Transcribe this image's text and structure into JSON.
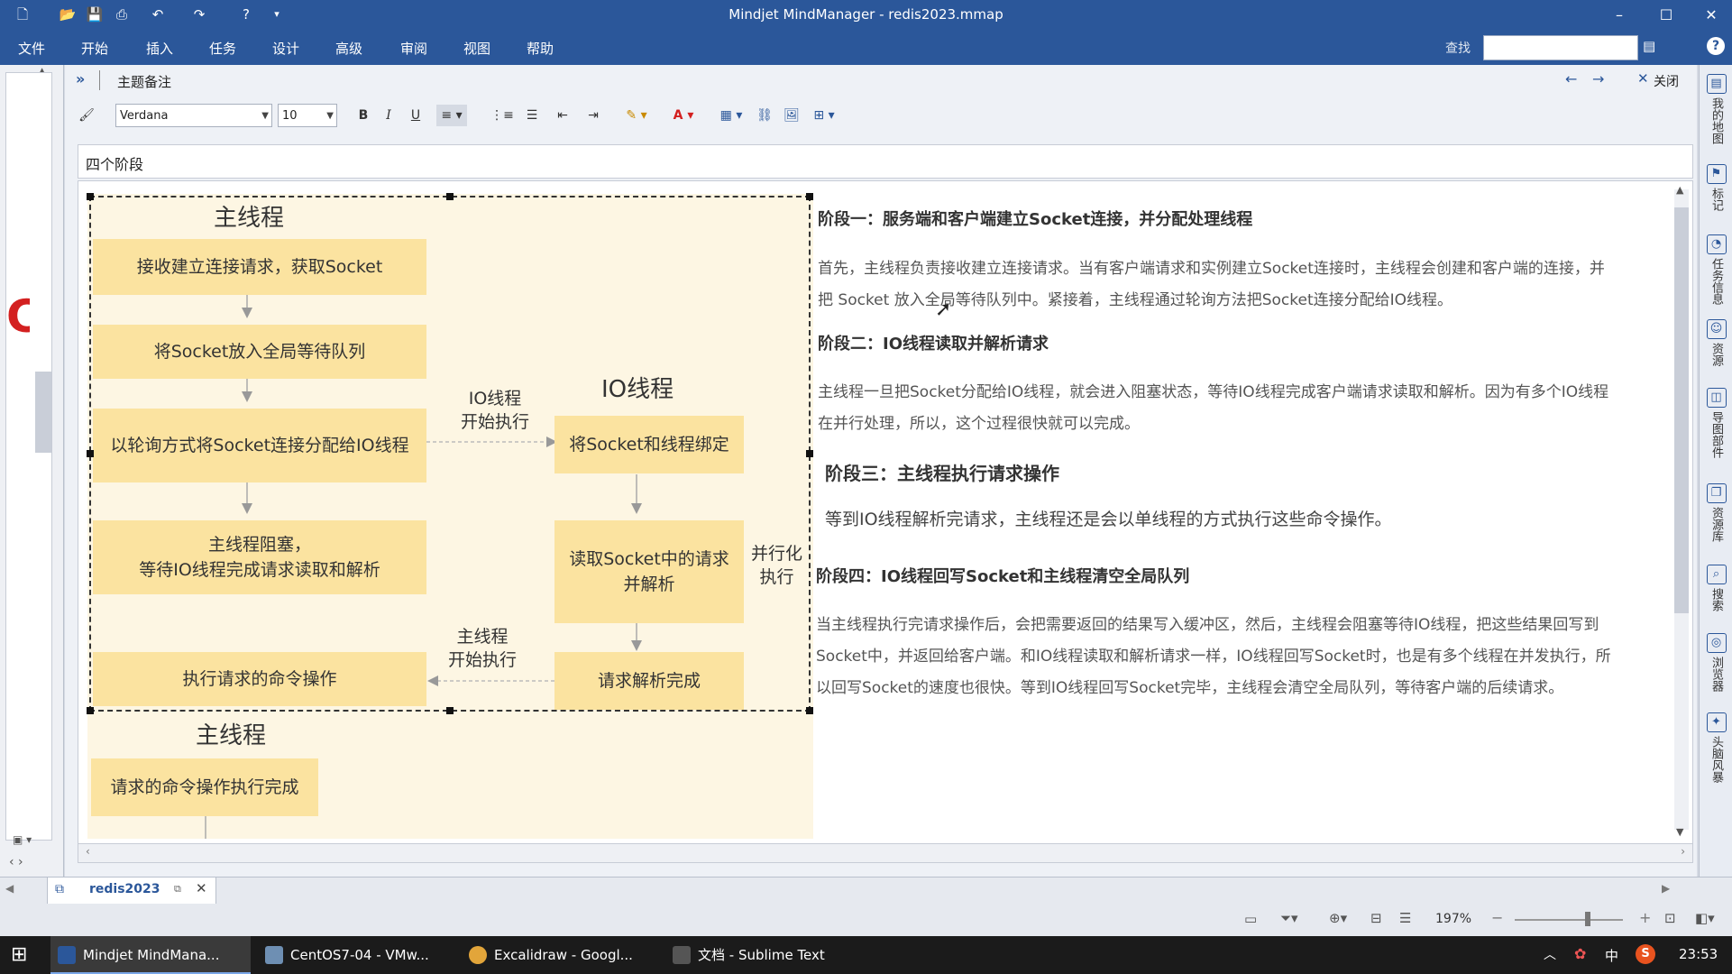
{
  "app": {
    "title": "Mindjet MindManager - redis2023.mmap"
  },
  "menu": [
    "文件",
    "开始",
    "插入",
    "任务",
    "设计",
    "高级",
    "审阅",
    "视图",
    "帮助"
  ],
  "menu_right": {
    "search_label": "查找"
  },
  "notes": {
    "panel_title": "主题备注",
    "close_label": "关闭",
    "font": "Verdana",
    "font_size": "10",
    "topic_title": "四个阶段"
  },
  "diagram": {
    "main_heading": "主线程",
    "io_heading": "IO线程",
    "main_heading_bottom": "主线程",
    "main_boxes": [
      "接收建立连接请求，获取Socket",
      "将Socket放入全局等待队列",
      "以轮询方式将Socket连接分配给IO线程",
      "主线程阻塞，\n等待IO线程完成请求读取和解析",
      "执行请求的命令操作"
    ],
    "io_boxes": [
      "将Socket和线程绑定",
      "读取Socket中的请求\n并解析",
      "请求解析完成"
    ],
    "final_box": "请求的命令操作执行完成",
    "label_io_start": "IO线程\n开始执行",
    "label_parallel": "并行化\n执行",
    "label_main_start": "主线程\n开始执行"
  },
  "stages": [
    {
      "title": "阶段一：服务端和客户端建立Socket连接，并分配处理线程",
      "body": "首先，主线程负责接收建立连接请求。当有客户端请求和实例建立Socket连接时，主线程会创建和客户端的连接，并\n把 Socket 放入全局等待队列中。紧接着，主线程通过轮询方法把Socket连接分配给IO线程。"
    },
    {
      "title": "阶段二：IO线程读取并解析请求",
      "body": "主线程一旦把Socket分配给IO线程，就会进入阻塞状态，等待IO线程完成客户端请求读取和解析。因为有多个IO线程\n在并行处理，所以，这个过程很快就可以完成。"
    },
    {
      "title": "阶段三：主线程执行请求操作",
      "body": "等到IO线程解析完请求，主线程还是会以单线程的方式执行这些命令操作。"
    },
    {
      "title": "阶段四：IO线程回写Socket和主线程清空全局队列",
      "body": "当主线程执行完请求操作后，会把需要返回的结果写入缓冲区，然后，主线程会阻塞等待IO线程，把这些结果回写到\nSocket中，并返回给客户端。和IO线程读取和解析请求一样，IO线程回写Socket时，也是有多个线程在并发执行，所\n以回写Socket的速度也很快。等到IO线程回写Socket完毕，主线程会清空全局队列，等待客户端的后续请求。"
    }
  ],
  "right_panel": [
    "我的地图",
    "标记",
    "任务信息",
    "资源",
    "导图部件",
    "资源库",
    "搜索",
    "浏览器",
    "头脑风暴"
  ],
  "doc_tab": "redis2023",
  "status": {
    "zoom": "197%"
  },
  "taskbar": {
    "apps": [
      "Mindjet MindMana...",
      "CentOS7-04 - VMw...",
      "Excalidraw - Googl...",
      "文档 - Sublime Text"
    ],
    "lang": "中",
    "time": "23:53"
  }
}
